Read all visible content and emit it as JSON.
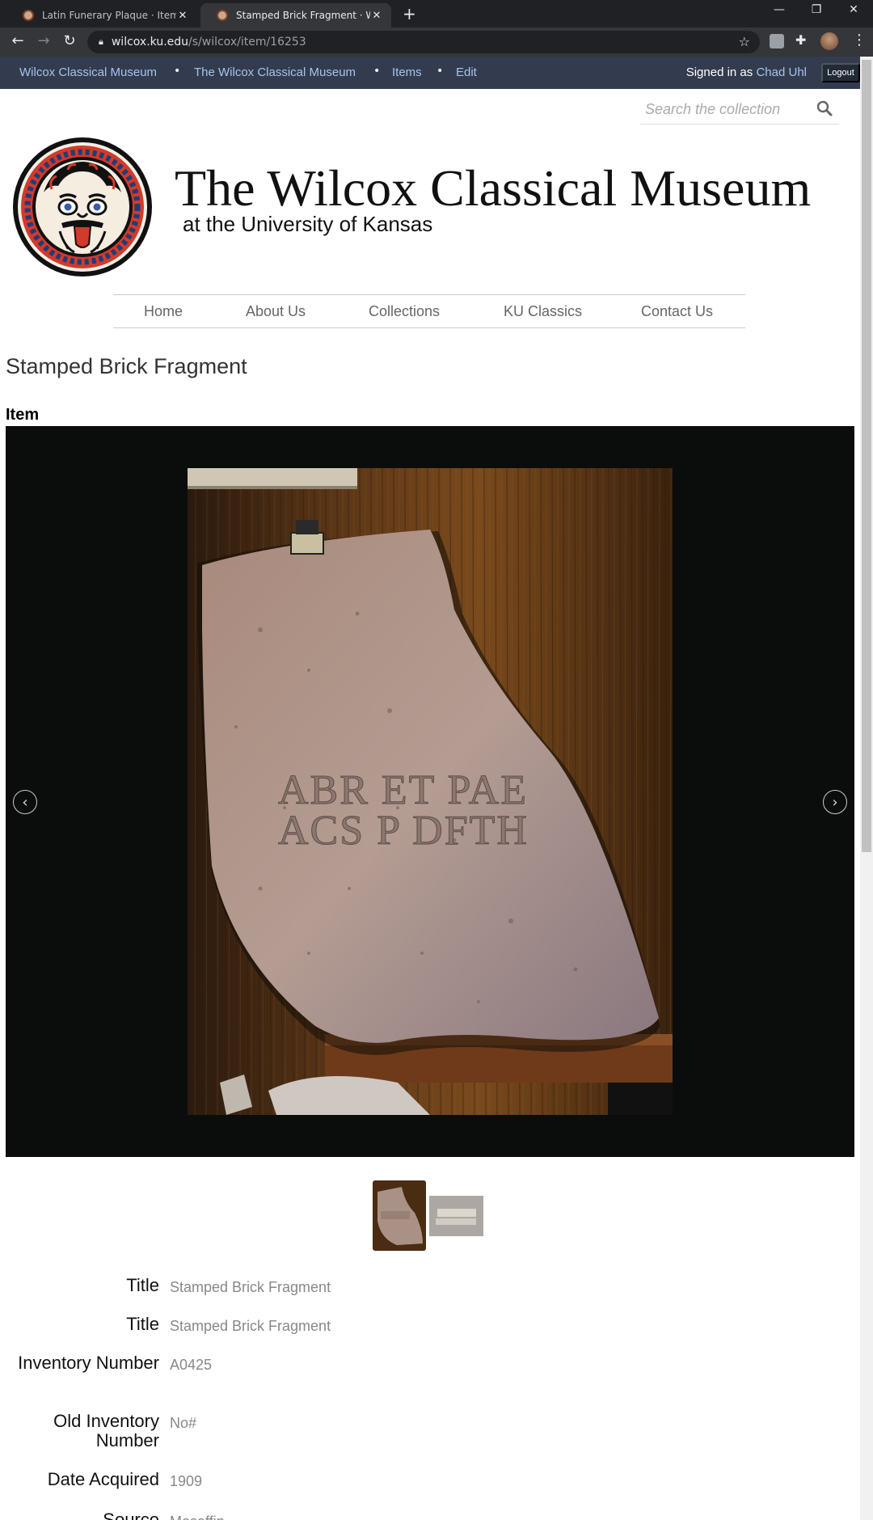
{
  "browser": {
    "tabs": [
      {
        "title": "Latin Funerary Plaque · Items · W",
        "active": false
      },
      {
        "title": "Stamped Brick Fragment · Wilco",
        "active": true
      }
    ],
    "url_domain": "wilcox.ku.edu",
    "url_path": "/s/wilcox/item/16253"
  },
  "admin_bar": {
    "links": [
      "Wilcox Classical Museum",
      "The Wilcox Classical Museum",
      "Items",
      "Edit"
    ],
    "signed_in_label": "Signed in as",
    "user": "Chad Uhl",
    "logout": "Logout"
  },
  "search": {
    "placeholder": "Search the collection"
  },
  "site": {
    "title": "The Wilcox Classical Museum",
    "subtitle": "at the University of Kansas"
  },
  "nav": [
    "Home",
    "About Us",
    "Collections",
    "KU Classics",
    "Contact Us"
  ],
  "page": {
    "title": "Stamped Brick Fragment",
    "section": "Item"
  },
  "brick_stamp": [
    "ABR ET PAE",
    "ACS P DFTH"
  ],
  "metadata": [
    {
      "label": "Title",
      "value": "Stamped Brick Fragment"
    },
    {
      "label": "Title",
      "value": "Stamped Brick Fragment"
    },
    {
      "label": "Inventory Number",
      "value": "A0425"
    },
    {
      "label": "Old Inventory Number",
      "value": "No#"
    },
    {
      "label": "Date Acquired",
      "value": "1909"
    },
    {
      "label": "Source",
      "value": "Mosaffin"
    }
  ],
  "colors": {
    "admin_bar": "#333c4e",
    "admin_link": "#a7c2ee",
    "viewer_bg": "#0b0c0c"
  }
}
